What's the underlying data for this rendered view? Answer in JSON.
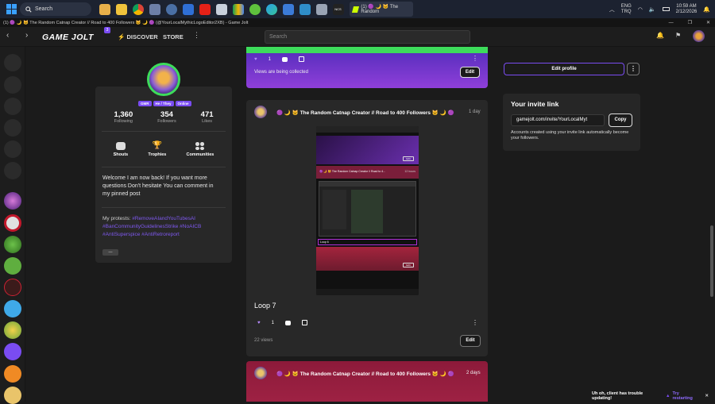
{
  "taskbar": {
    "search_placeholder": "Search",
    "active_window_label": "(1) 🟣 🌙 🐱 The Random",
    "tray": {
      "lang_top": "ENG",
      "lang_bottom": "TRQ",
      "time": "10:59 AM",
      "date": "2/12/2026"
    }
  },
  "titlebar": {
    "title": "(1) 🟣 🌙 🐱 The Random Catnap Creator // Road to 400 Followers 🐱 🌙 🟣 (@YourLocalMythicLogoEditor2XB) - Game Jolt"
  },
  "header": {
    "logo": "GAME JOLT",
    "notification_count": "3",
    "discover": "DISCOVER",
    "store": "STORE",
    "more": "⋮",
    "search_placeholder": "Search"
  },
  "profile": {
    "badges": [
      "GMR",
      "He / They",
      "Online"
    ],
    "stats": [
      {
        "value": "1,360",
        "label": "Following"
      },
      {
        "value": "354",
        "label": "Followers"
      },
      {
        "value": "471",
        "label": "Likes"
      }
    ],
    "actions": [
      {
        "label": "Shouts"
      },
      {
        "label": "Trophies"
      },
      {
        "label": "Communities"
      }
    ],
    "bio": "Welcome I am now back! If you want more questions Don't hesitate You can comment in my pinned post",
    "protests_label": "My protests:",
    "protest_tags": "#RemoveAIandYouTubesAI #BanCommunityGuidelinesStrike #NoAICB #AntiSuperspice #AntiRetroreport",
    "more_button": "—"
  },
  "posts": {
    "top": {
      "likes": "1",
      "collecting": "Views are being collected",
      "edit": "Edit"
    },
    "main": {
      "author": "🟣 🌙 🐱 The Random Catnap Creator // Road to 400 Followers 🐱 🌙 🟣",
      "time": "1 day",
      "title": "Loop 7",
      "likes": "1",
      "views": "22 views",
      "edit": "Edit",
      "thumb": {
        "row1_title": "🟣 🌙 🐱 The Random Catnap Creator // Road to 4...",
        "row1_time": "12 hours",
        "loop_label": "Loop 6",
        "edit": "Edit"
      }
    },
    "next": {
      "author": "🟣 🌙 🐱 The Random Catnap Creator // Road to 400 Followers 🐱 🌙 🟣",
      "time": "2 days"
    }
  },
  "right": {
    "edit_profile": "Edit profile",
    "invite_title": "Your invite link",
    "invite_url": "gamejolt.com/invite/YourLocalMyt",
    "copy": "Copy",
    "invite_desc": "Accounts created using your invite link automatically become your followers."
  },
  "toast": {
    "message": "Uh oh, client has trouble updating!",
    "action": "Try restarting"
  },
  "colors": {
    "accent": "#7a4cf2",
    "brand_green": "#3ddc5b",
    "post_header_purple": "#5b2fbf",
    "post_header_red": "#8c1a3a"
  }
}
